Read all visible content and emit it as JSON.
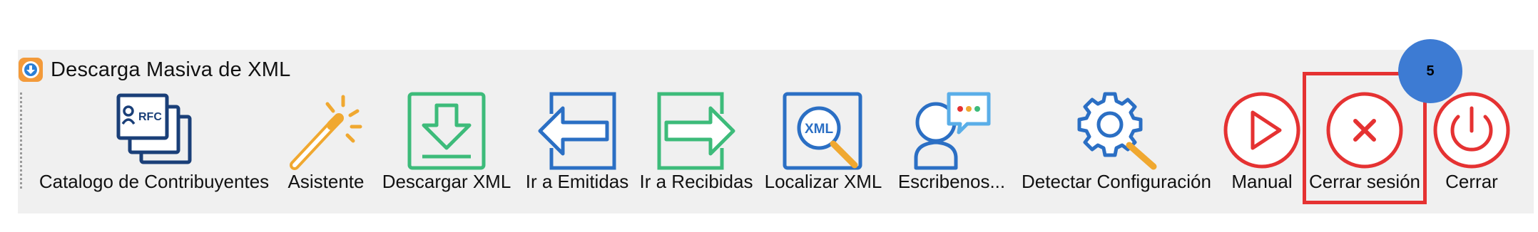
{
  "window": {
    "title": "Descarga Masiva de XML",
    "app_icon": "app-icon"
  },
  "toolbar": {
    "buttons": [
      {
        "label": "Catalogo de Contribuyentes",
        "icon": "rfc-cards-icon",
        "icon_text": "RFC"
      },
      {
        "label": "Asistente",
        "icon": "magic-wand-icon"
      },
      {
        "label": "Descargar XML",
        "icon": "download-icon"
      },
      {
        "label": "Ir a Emitidas",
        "icon": "arrow-left-icon"
      },
      {
        "label": "Ir a Recibidas",
        "icon": "arrow-right-icon"
      },
      {
        "label": "Localizar XML",
        "icon": "search-xml-icon",
        "icon_text": "XML"
      },
      {
        "label": "Escribenos...",
        "icon": "user-chat-icon"
      },
      {
        "label": "Detectar Configuración",
        "icon": "gear-search-icon"
      },
      {
        "label": "Manual",
        "icon": "play-icon"
      },
      {
        "label": "Cerrar sesión",
        "icon": "close-x-icon"
      },
      {
        "label": "Cerrar",
        "icon": "power-icon"
      }
    ]
  },
  "annotation": {
    "step_number": "5",
    "highlight_target": "Cerrar sesión",
    "color": "#e53232",
    "badge_color": "#3d7bd3"
  },
  "colors": {
    "blue": "#2b6fc4",
    "orange": "#f0a830",
    "green": "#3dbb7a",
    "red": "#e53232",
    "light_blue": "#5aaee8"
  }
}
